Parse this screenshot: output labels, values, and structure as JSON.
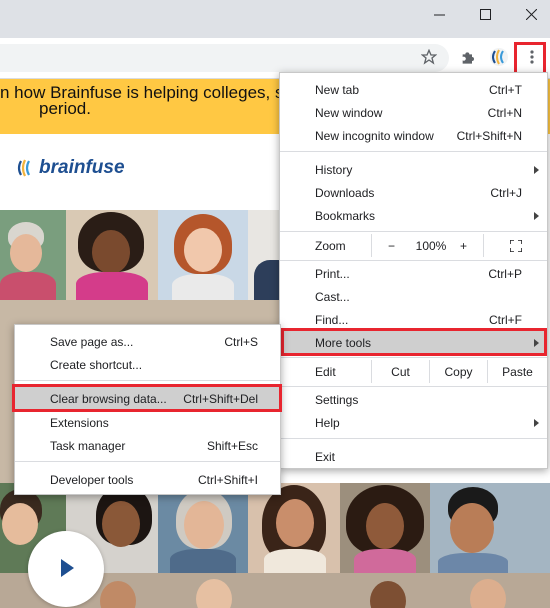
{
  "window": {
    "minimize_icon": "minimize-icon",
    "maximize_icon": "maximize-icon",
    "close_icon": "close-icon"
  },
  "toolbar": {
    "bookmark_icon": "star-icon",
    "extensions_icon": "puzzle-icon",
    "profile_icon": "profile-avatar",
    "menu_icon": "three-dots-icon"
  },
  "page": {
    "banner_line1": "n how Brainfuse is helping colleges, s",
    "banner_line2": "period.",
    "logo_text": "brainfuse"
  },
  "chrome_menu": {
    "new_tab": {
      "label": "New tab",
      "shortcut": "Ctrl+T"
    },
    "new_window": {
      "label": "New window",
      "shortcut": "Ctrl+N"
    },
    "new_incognito": {
      "label": "New incognito window",
      "shortcut": "Ctrl+Shift+N"
    },
    "history": {
      "label": "History"
    },
    "downloads": {
      "label": "Downloads",
      "shortcut": "Ctrl+J"
    },
    "bookmarks": {
      "label": "Bookmarks"
    },
    "zoom": {
      "label": "Zoom",
      "minus": "−",
      "value": "100%",
      "plus": "+"
    },
    "print": {
      "label": "Print...",
      "shortcut": "Ctrl+P"
    },
    "cast": {
      "label": "Cast..."
    },
    "find": {
      "label": "Find...",
      "shortcut": "Ctrl+F"
    },
    "more_tools": {
      "label": "More tools"
    },
    "edit": {
      "label": "Edit",
      "cut": "Cut",
      "copy": "Copy",
      "paste": "Paste"
    },
    "settings": {
      "label": "Settings"
    },
    "help": {
      "label": "Help"
    },
    "exit": {
      "label": "Exit"
    }
  },
  "more_tools_menu": {
    "save_page": {
      "label": "Save page as...",
      "shortcut": "Ctrl+S"
    },
    "create_shortcut": {
      "label": "Create shortcut..."
    },
    "clear_browsing": {
      "label": "Clear browsing data...",
      "shortcut": "Ctrl+Shift+Del"
    },
    "extensions": {
      "label": "Extensions"
    },
    "task_manager": {
      "label": "Task manager",
      "shortcut": "Shift+Esc"
    },
    "developer_tools": {
      "label": "Developer tools",
      "shortcut": "Ctrl+Shift+I"
    }
  },
  "colors": {
    "highlight_box": "#e8252f",
    "banner": "#ffc843",
    "brand": "#1e4f91"
  }
}
